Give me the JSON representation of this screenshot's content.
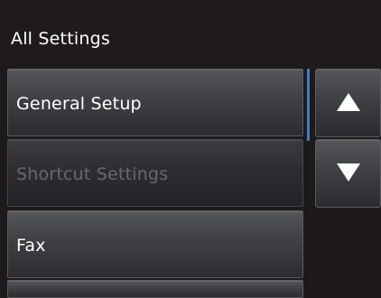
{
  "header": {
    "title": "All Settings"
  },
  "menu": {
    "items": [
      {
        "label": "General Setup",
        "enabled": true
      },
      {
        "label": "Shortcut Settings",
        "enabled": false
      },
      {
        "label": "Fax",
        "enabled": true
      }
    ]
  },
  "scroll": {
    "up_icon": "triangle-up-icon",
    "down_icon": "triangle-down-icon"
  },
  "colors": {
    "background": "#1e1a1a",
    "button_top": "#545659",
    "button_bottom": "#2b2c2f",
    "disabled_text": "#66686b",
    "scrollbar_accent": "#3d7ec9"
  }
}
